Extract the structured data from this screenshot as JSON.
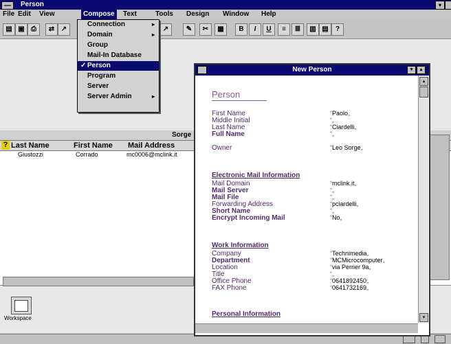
{
  "window": {
    "title": "Person"
  },
  "menubar": [
    "File",
    "Edit",
    "View",
    "Compose",
    "Text",
    "Tools",
    "Design",
    "Window",
    "Help"
  ],
  "compose_menu": [
    {
      "label": "Connection",
      "submenu": true
    },
    {
      "label": "Domain",
      "submenu": true
    },
    {
      "label": "Group",
      "submenu": false
    },
    {
      "label": "Mail-In Database",
      "submenu": false
    },
    {
      "label": "Person",
      "submenu": false,
      "checked": true
    },
    {
      "label": "Program",
      "submenu": false
    },
    {
      "label": "Server",
      "submenu": false
    },
    {
      "label": "Server Admin",
      "submenu": true
    }
  ],
  "toolbar": {
    "bold": "B",
    "italic": "I",
    "underline": "U"
  },
  "view": {
    "title_fragment": "Sorge",
    "columns": [
      "Last Name",
      "First Name",
      "Mail Address"
    ],
    "rows": [
      {
        "last": "Giustozzi",
        "first": "Corrado",
        "mail": "mc0006@mclink.it"
      }
    ]
  },
  "workspace": {
    "label": "Workspace"
  },
  "form": {
    "window_title": "New Person",
    "heading": "Person",
    "fields": [
      {
        "label": "First Name",
        "value": "Paolo",
        "bold": false
      },
      {
        "label": "Middle Initial",
        "value": "",
        "bold": false
      },
      {
        "label": "Last Name",
        "value": "Ciardelli",
        "bold": false
      },
      {
        "label": "Full Name",
        "value": "",
        "bold": true
      },
      {
        "label": "Owner",
        "value": "Leo Sorge",
        "bold": false
      }
    ],
    "sections": [
      {
        "title": "Electronic Mail Information",
        "fields": [
          {
            "label": "Mail Domain",
            "value": "mclink.it",
            "bold": false
          },
          {
            "label": "Mail Server",
            "value": "",
            "bold": true
          },
          {
            "label": "Mail File",
            "value": "",
            "bold": true
          },
          {
            "label": "Forwarding Address",
            "value": "pciardelli",
            "bold": false
          },
          {
            "label": "Short Name",
            "value": "",
            "bold": true
          },
          {
            "label": "Encrypt Incoming Mail",
            "value": "No",
            "bold": true
          }
        ]
      },
      {
        "title": "Work Information",
        "fields": [
          {
            "label": "Company",
            "value": "Technimedia",
            "bold": false
          },
          {
            "label": "Department",
            "value": "MCMicrocomputer",
            "bold": true
          },
          {
            "label": "Location",
            "value": "via Perrier 9a",
            "bold": false
          },
          {
            "label": "Title",
            "value": "",
            "bold": false
          },
          {
            "label": "Office Phone",
            "value": "0641892450",
            "bold": false
          },
          {
            "label": "FAX Phone",
            "value": "0641732169",
            "bold": false
          }
        ]
      },
      {
        "title": "Personal Information",
        "fields": []
      }
    ]
  }
}
